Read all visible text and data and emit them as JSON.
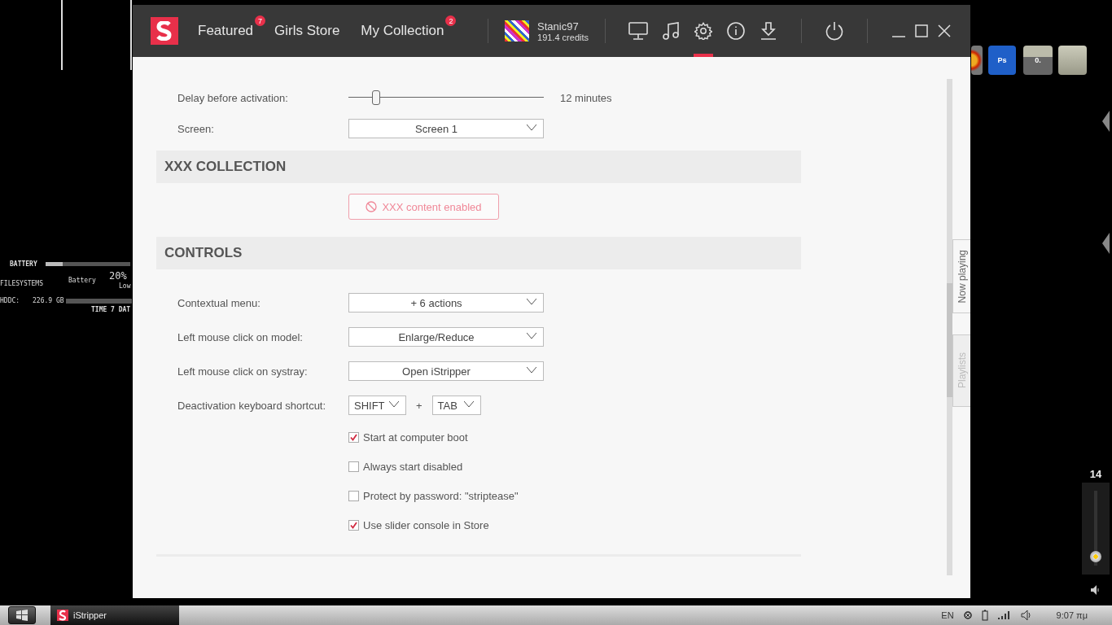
{
  "desktop": {
    "battery_widget": {
      "title": "BATTERY",
      "label": "Battery",
      "percent": "20%",
      "status": "Low",
      "filesystems": "FILESYSTEMS",
      "drive": "HDDC:",
      "size": "226.9 GB",
      "time_label": "TIME 7 DAT",
      "level": 0.2
    },
    "icons": [
      {
        "kind": "disc"
      },
      {
        "kind": "photoshop",
        "text": "Ps"
      },
      {
        "kind": "calculator",
        "text": "0."
      },
      {
        "kind": "bin"
      }
    ],
    "volume": {
      "value": "14",
      "level": 0.12
    }
  },
  "window": {
    "nav": [
      {
        "label": "Featured",
        "badge": "7"
      },
      {
        "label": "Girls Store"
      },
      {
        "label": "My Collection",
        "badge": "2"
      }
    ],
    "user": {
      "name": "Stanic97",
      "credits": "191.4 credits"
    },
    "toolbar": [
      {
        "kind": "monitor",
        "selected": false
      },
      {
        "kind": "music",
        "selected": false
      },
      {
        "kind": "settings",
        "selected": true
      },
      {
        "kind": "info",
        "selected": false
      },
      {
        "kind": "download",
        "selected": false
      }
    ],
    "sections": [
      {
        "rows": [
          {
            "kind": "slider",
            "label": "Delay before activation:",
            "level": 0.14,
            "reading": "12 minutes"
          },
          {
            "kind": "select",
            "label": "Screen:",
            "value": "Screen 1"
          }
        ]
      },
      {
        "title": "XXX COLLECTION",
        "rows": [
          {
            "kind": "button",
            "value": "XXX content enabled"
          }
        ]
      },
      {
        "title": "CONTROLS",
        "rows": [
          {
            "kind": "select",
            "label": "Contextual menu:",
            "value": "+ 6 actions"
          },
          {
            "kind": "select",
            "label": "Left mouse click on model:",
            "value": "Enlarge/Reduce"
          },
          {
            "kind": "select",
            "label": "Left mouse click on systray:",
            "value": "Open iStripper"
          },
          {
            "kind": "keys",
            "label": "Deactivation keyboard shortcut:",
            "keys": [
              "SHIFT",
              "TAB"
            ],
            "joiner": "+"
          },
          {
            "kind": "checkbox",
            "label": "Start at computer boot",
            "checked": true
          },
          {
            "kind": "checkbox",
            "label": "Always start disabled",
            "checked": false
          },
          {
            "kind": "checkbox",
            "label": "Protect by password: \"striptease\"",
            "checked": false
          },
          {
            "kind": "checkbox",
            "label": "Use slider console in Store",
            "checked": true
          }
        ]
      }
    ],
    "side_tabs": [
      {
        "label": "Now playing",
        "selected": true
      },
      {
        "label": "Playlists",
        "selected": false
      }
    ]
  },
  "taskbar": {
    "task": "iStripper",
    "language": "EN",
    "time": "9:07 πμ"
  }
}
